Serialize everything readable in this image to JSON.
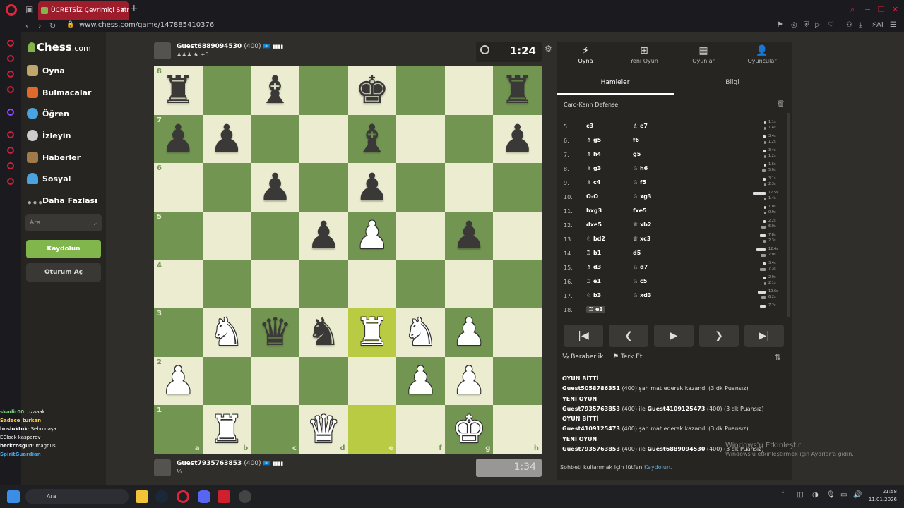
{
  "browser": {
    "tab_title": "ÜCRETSİZ Çevrimiçi Satranç",
    "tab_close": "✕",
    "new_tab": "+",
    "url": "www.chess.com/game/147885410376",
    "back": "‹",
    "forward": "›",
    "reload": "↻",
    "window_controls": [
      "⌕",
      "−",
      "❐",
      "✕"
    ]
  },
  "sidebar": {
    "logo": "Chess",
    "logo_suffix": ".com",
    "items": [
      {
        "label": "Oyna",
        "icon": "play-icon",
        "color": "#c0a66a"
      },
      {
        "label": "Bulmacalar",
        "icon": "puzzle-icon",
        "color": "#e06a2c"
      },
      {
        "label": "Öğren",
        "icon": "learn-icon",
        "color": "#4aa3df"
      },
      {
        "label": "İzleyin",
        "icon": "binoculars-icon",
        "color": "#cccccc"
      },
      {
        "label": "Haberler",
        "icon": "news-icon",
        "color": "#a17a4b"
      },
      {
        "label": "Sosyal",
        "icon": "social-icon",
        "color": "#4aa3df"
      },
      {
        "label": "Daha Fazlası",
        "icon": "more-icon",
        "color": "#aaaaaa"
      }
    ],
    "search_placeholder": "Ara",
    "signup": "Kaydolun",
    "login": "Oturum Aç"
  },
  "stream_chat": [
    {
      "user": "skadir00",
      "text": ": uzaaak",
      "color": "#7ad37a"
    },
    {
      "user": "Sadece_turkan",
      "text": "",
      "color": "#ffd24a"
    },
    {
      "user": "",
      "text": "",
      "color": "#e0253b"
    },
    {
      "user": "bosluktuk",
      "text": ": Sebo oaşa",
      "color": "#ffffff"
    },
    {
      "user": "",
      "text": "ECIock kasparov",
      "color": "#ffffff"
    },
    {
      "user": "berkcosgun",
      "text": ": magnus",
      "color": "#ffffff"
    },
    {
      "user": "",
      "text": "",
      "color": "#e0253b"
    },
    {
      "user": "SpiritGuardian",
      "text": "",
      "color": "#4aa3df"
    }
  ],
  "top_player": {
    "name": "Guest6889094530",
    "rating": "(400)",
    "captured": "♟♟♟ ♞ +5"
  },
  "bottom_player": {
    "name": "Guest7935763853",
    "rating": "(400)",
    "captured": "½"
  },
  "clocks": {
    "top": "1:24",
    "bottom": "1:34"
  },
  "board": {
    "light": "#ebecd0",
    "dark": "#739552",
    "highlight_light": "#f5f682",
    "highlight_dark": "#b9ca43",
    "ranks": [
      "8",
      "7",
      "6",
      "5",
      "4",
      "3",
      "2",
      "1"
    ],
    "files": [
      "a",
      "b",
      "c",
      "d",
      "e",
      "f",
      "g",
      "h"
    ],
    "highlighted": [
      "e3",
      "e1"
    ],
    "pieces": [
      {
        "sq": "a8",
        "p": "r"
      },
      {
        "sq": "c8",
        "p": "b"
      },
      {
        "sq": "e8",
        "p": "k"
      },
      {
        "sq": "h8",
        "p": "r"
      },
      {
        "sq": "a7",
        "p": "p"
      },
      {
        "sq": "b7",
        "p": "p"
      },
      {
        "sq": "e7",
        "p": "b"
      },
      {
        "sq": "h7",
        "p": "p"
      },
      {
        "sq": "c6",
        "p": "p"
      },
      {
        "sq": "e6",
        "p": "p"
      },
      {
        "sq": "d5",
        "p": "p"
      },
      {
        "sq": "e5",
        "p": "P"
      },
      {
        "sq": "g5",
        "p": "p"
      },
      {
        "sq": "b3",
        "p": "N"
      },
      {
        "sq": "c3",
        "p": "q"
      },
      {
        "sq": "d3",
        "p": "n"
      },
      {
        "sq": "e3",
        "p": "R"
      },
      {
        "sq": "f3",
        "p": "N"
      },
      {
        "sq": "g3",
        "p": "P"
      },
      {
        "sq": "a2",
        "p": "P"
      },
      {
        "sq": "f2",
        "p": "P"
      },
      {
        "sq": "g2",
        "p": "P"
      },
      {
        "sq": "b1",
        "p": "R"
      },
      {
        "sq": "d1",
        "p": "Q"
      },
      {
        "sq": "g1",
        "p": "K"
      }
    ]
  },
  "panel": {
    "tabs": [
      {
        "label": "Oyna",
        "icon": "⚡"
      },
      {
        "label": "Yeni Oyun",
        "icon": "⊞"
      },
      {
        "label": "Oyunlar",
        "icon": "▦"
      },
      {
        "label": "Oyuncular",
        "icon": "👤"
      }
    ],
    "subtabs": [
      "Hamleler",
      "Bilgi"
    ],
    "opening": "Caro-Kann Defense",
    "moves": [
      {
        "n": "5.",
        "w": "c3",
        "b": "♗ e7",
        "tw": 0.05,
        "tb": 0.1,
        "t1": "1.1s",
        "t2": "1.4s"
      },
      {
        "n": "6.",
        "w": "♗ g5",
        "b": "f6",
        "tw": 0.25,
        "tb": 0.08,
        "t1": "3.4s",
        "t2": "1.2s"
      },
      {
        "n": "7.",
        "w": "♗ h4",
        "b": "g5",
        "tw": 0.25,
        "tb": 0.08,
        "t1": "3.4s",
        "t2": "1.2s"
      },
      {
        "n": "8.",
        "w": "♗ g3",
        "b": "♘ h6",
        "tw": 0.12,
        "tb": 0.3,
        "t1": "1.6s",
        "t2": "5.0s"
      },
      {
        "n": "9.",
        "w": "♗ c4",
        "b": "♘ f5",
        "tw": 0.2,
        "tb": 0.12,
        "t1": "3.1s",
        "t2": "2.3s"
      },
      {
        "n": "10.",
        "w": "O-O",
        "b": "♘ xg3",
        "tw": 1.0,
        "tb": 0.08,
        "t1": "17.5s",
        "t2": "1.4s"
      },
      {
        "n": "11.",
        "w": "hxg3",
        "b": "fxe5",
        "tw": 0.07,
        "tb": 0.07,
        "t1": "1.0s",
        "t2": "0.9s"
      },
      {
        "n": "12.",
        "w": "dxe5",
        "b": "♕ xb2",
        "tw": 0.14,
        "tb": 0.35,
        "t1": "2.2s",
        "t2": "6.0s"
      },
      {
        "n": "13.",
        "w": "♘ bd2",
        "b": "♕ xc3",
        "tw": 0.45,
        "tb": 0.15,
        "t1": "7.8s",
        "t2": "2.3s"
      },
      {
        "n": "14.",
        "w": "♖ b1",
        "b": "d5",
        "tw": 0.72,
        "tb": 0.4,
        "t1": "12.4s",
        "t2": "7.0s"
      },
      {
        "n": "15.",
        "w": "♗ d3",
        "b": "♘ d7",
        "tw": 0.2,
        "tb": 0.42,
        "t1": "3.4s",
        "t2": "7.3s"
      },
      {
        "n": "16.",
        "w": "♖ e1",
        "b": "♘ c5",
        "tw": 0.17,
        "tb": 0.13,
        "t1": "2.9s",
        "t2": "2.1s"
      },
      {
        "n": "17.",
        "w": "♘ b3",
        "b": "♘ xd3",
        "tw": 0.62,
        "tb": 0.36,
        "t1": "10.6s",
        "t2": "6.2s"
      },
      {
        "n": "18.",
        "w": "♖ e3",
        "b": "",
        "tw": 0.42,
        "tb": 0,
        "t1": "7.2s",
        "t2": ""
      }
    ],
    "nav": [
      "|◀",
      "◀",
      "▶",
      "▶",
      "▶|"
    ],
    "draw": "Beraberlik",
    "draw_icon": "½",
    "resign": "Terk Et",
    "resign_icon": "⚑",
    "flip_icon": "⇅",
    "log": [
      {
        "h": "OYUN BİTTİ",
        "t1": "Guest5058786351",
        "t2": " (400) şah mat ederek kazandı (3 dk Puansız)",
        "t3": ""
      },
      {
        "h": "YENİ OYUN",
        "t1": "Guest7935763853",
        "t2": " (400) ile ",
        "t3": "Guest4109125473",
        "t4": " (400) (3 dk Puansız)"
      },
      {
        "h": "OYUN BİTTİ",
        "t1": "Guest4109125473",
        "t2": " (400) şah mat ederek kazandı (3 dk Puansız)",
        "t3": ""
      },
      {
        "h": "YENİ OYUN",
        "t1": "Guest7935763853",
        "t2": " (400) ile ",
        "t3": "Guest6889094530",
        "t4": " (400) (3 dk Puansız)"
      }
    ],
    "chat_note": "Sohbeti kullanmak için lütfen ",
    "chat_link": "Kaydolun."
  },
  "watermark": {
    "title": "Windows'u Etkinleştir",
    "sub": "Windows'u etkinleştirmek için Ayarlar'a gidin."
  },
  "taskbar": {
    "search": "Ara",
    "time": "21:58",
    "date": "11.01.2026"
  }
}
